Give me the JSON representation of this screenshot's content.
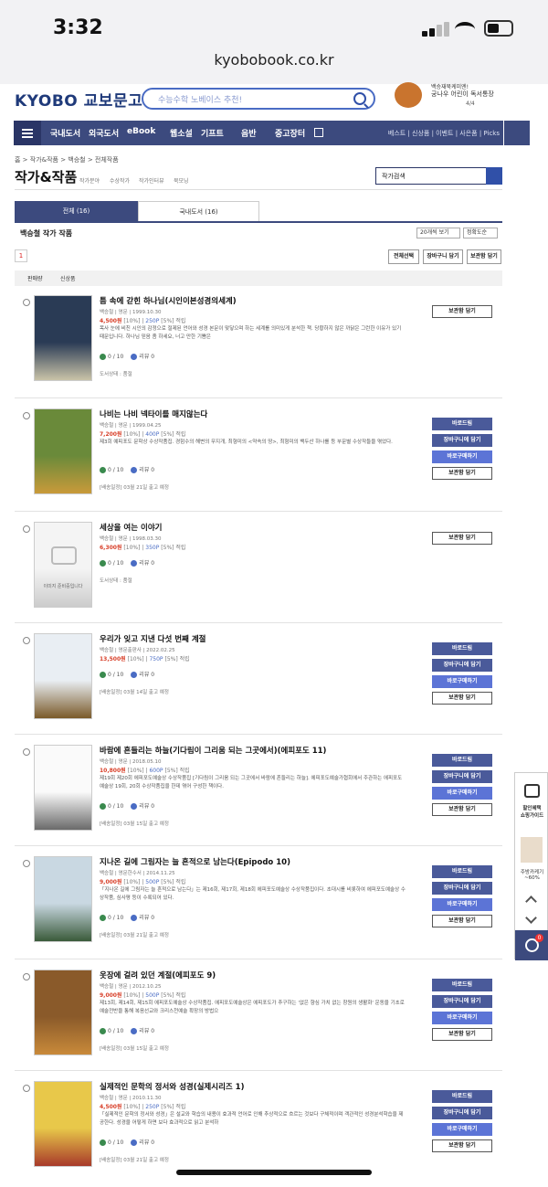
{
  "status": {
    "time": "3:32"
  },
  "url": "kyobobook.co.kr",
  "header": {
    "logo_en": "KYOBO",
    "logo_kr": "교보문고",
    "search_placeholder": "수능수학 노베이스 추천!",
    "promo_line1": "백승재북케미엔!",
    "promo_line2": "궁나우 어린이 독서통장",
    "promo_page": "4/4"
  },
  "nav": {
    "items": [
      "국내도서",
      "외국도서",
      "eBook",
      "웹소설",
      "기프트",
      "음반",
      "중고장터"
    ],
    "right": "베스트 | 신상품 | 이벤트 | 사은품 | Picks"
  },
  "breadcrumb": "홈 > 작가&작품 > 백승철 > 전체작품",
  "page_title": "작가&작품",
  "subnav": [
    "작가분야",
    "수상작가",
    "작가인터뷰",
    "북모닝"
  ],
  "author_search": "작가검색",
  "tabs": {
    "all": "전체 (16)",
    "foreign": "국내도서 (16)"
  },
  "section_title": "백승철 작가 작품",
  "view_select": "20개씩 보기",
  "sort_select": "정확도순",
  "page_current": "1",
  "toolbar": {
    "select_all": "전체선택",
    "cart": "장바구니 담기",
    "keep": "보관함 담기"
  },
  "sort": {
    "sales": "판매량",
    "new": "신상품"
  },
  "buttons": {
    "buy_now": "바로드림",
    "add_cart": "장바구니에 담기",
    "buy": "바로구매하기",
    "keep": "보관함 담기"
  },
  "books": [
    {
      "title": "틈 속에 갇힌 하나님(시인이본성경의세계)",
      "meta": "백승철 | 영문 | 1999.10.30",
      "price": "4,500원",
      "disc": "[10%]",
      "point": "250P",
      "pct": "[5%] 적립",
      "desc": "목사 눈에 비친 시인의 감정으로 절제된 언어와 성경 본문이 맞닿으며 하는 세계를 의미있게 분석한 책. 당황하지 않은 까닭은 그런한 이유가 있기 때문입니다. 하나님 믿음 좀 하세요, 너고 만한 기쁨은",
      "rate": "0 / 10",
      "review": "리뷰 0",
      "ship": "도서상태 : 품절",
      "soldout": true
    },
    {
      "title": "나비는 나비 넥타이를 매지않는다",
      "meta": "백승철 | 영문 | 1999.04.25",
      "price": "7,200원",
      "disc": "[10%]",
      "point": "400P",
      "pct": "[5%] 적립",
      "desc": "제3회 예피포도 문학상 수상작품집. 경험수의 해변의 무지개, 최형미의 <약속의 땅>, 최형미의 백두산 하나를 등 부문별 수상작들을 엮었다.",
      "rate": "0 / 10",
      "review": "리뷰 0",
      "ship": "[배송일정] 03월 21일 출고 예정",
      "soldout": false
    },
    {
      "title": "세상을 여는 이야기",
      "meta": "백승철 | 영문 | 1998.03.30",
      "price": "6,300원",
      "disc": "[10%]",
      "point": "350P",
      "pct": "[5%] 적립",
      "desc": "",
      "rate": "0 / 10",
      "review": "리뷰 0",
      "ship": "도서상태 : 품절",
      "soldout": true,
      "no_image": "이미지 준비중입니다"
    },
    {
      "title": "우리가 잊고 지낸 다섯 번째 계절",
      "meta": "백승철 | 영문출판사 | 2022.02.25",
      "price": "13,500원",
      "disc": "[10%]",
      "point": "750P",
      "pct": "[5%] 적립",
      "desc": "",
      "rate": "0 / 10",
      "review": "리뷰 0",
      "ship": "[배송일정] 03월 14일 출고 예정",
      "soldout": false
    },
    {
      "title": "바람에 흔들리는 하늘(기다림이 그리움 되는 그곳에서)(에피포도 11)",
      "meta": "백승철 | 영문 | 2018.05.10",
      "price": "10,800원",
      "disc": "[10%]",
      "point": "600P",
      "pct": "[5%] 적립",
      "desc": "제19회 제20회 에피포도예술상 수상작품집 [기다림이 그리움 되는 그곳에서 바람에 흔들리는 하늘]. 에피포도예술가협회에서 주관하는 에피포도예술상 19회, 20회 수상작품집을 한데 엮어 구성한 책이다.",
      "rate": "0 / 10",
      "review": "리뷰 0",
      "ship": "[배송일정] 03월 15일 출고 예정",
      "soldout": false
    },
    {
      "title": "지나온 길에 그림자는 늘 흔적으로 남는다(Epipodo 10)",
      "meta": "백승철 | 영문한수서 | 2014.11.25",
      "price": "9,000원",
      "disc": "[10%]",
      "point": "500P",
      "pct": "[5%] 적립",
      "desc": "「지나온 길에 그림자는 늘 흔적으로 남는다」는 제16회, 제17회, 제18회 에피포도예술상 수상작품집이다. 초대시를 비롯하여 에피포도예술상 수상작품, 심사평 등이 수록되어 있다.",
      "rate": "0 / 10",
      "review": "리뷰 0",
      "ship": "[배송일정] 03월 21일 출고 예정",
      "soldout": false
    },
    {
      "title": "옷장에 걸려 있던 계절(에피포도 9)",
      "meta": "백승철 | 영문 | 2012.10.25",
      "price": "9,000원",
      "disc": "[10%]",
      "point": "500P",
      "pct": "[5%] 적립",
      "desc": "제13회, 제14회, 제15회 에피포도예술상 수상작품집. 에피포도예술상은 에피포도가 추구하는 '없은 향심 가치 없는 창원의 생활화' 운동을 기초로 예술전반을 통해 복음선교와 크리스천예술 확장의 방법으",
      "rate": "0 / 10",
      "review": "리뷰 0",
      "ship": "[배송일정] 03월 15일 출고 예정",
      "soldout": false
    },
    {
      "title": "실제적인 문학의 정서와 성경(실제시리즈 1)",
      "meta": "백승철 | 영문 | 2010.11.30",
      "price": "4,500원",
      "disc": "[10%]",
      "point": "250P",
      "pct": "[5%] 적립",
      "desc": "「실제적인 문학의 정서와 성경」은 설교와 학습의 내용이 효과적 언어로 인해 추상적으로 흐르는 것보다 구체적이며 객관적인 성경분석학습을 제공한다. 성경을 어떻게 하면 보다 효과적으로 읽고 분석하",
      "rate": "0 / 10",
      "review": "리뷰 0",
      "ship": "[배송일정] 03월 21일 출고 예정",
      "soldout": false
    }
  ],
  "float": {
    "guide1": "할인혜택",
    "guide2": "쇼핑가이드",
    "recent": "주방카케기",
    "recent_pct": "~60%",
    "count": "0"
  }
}
